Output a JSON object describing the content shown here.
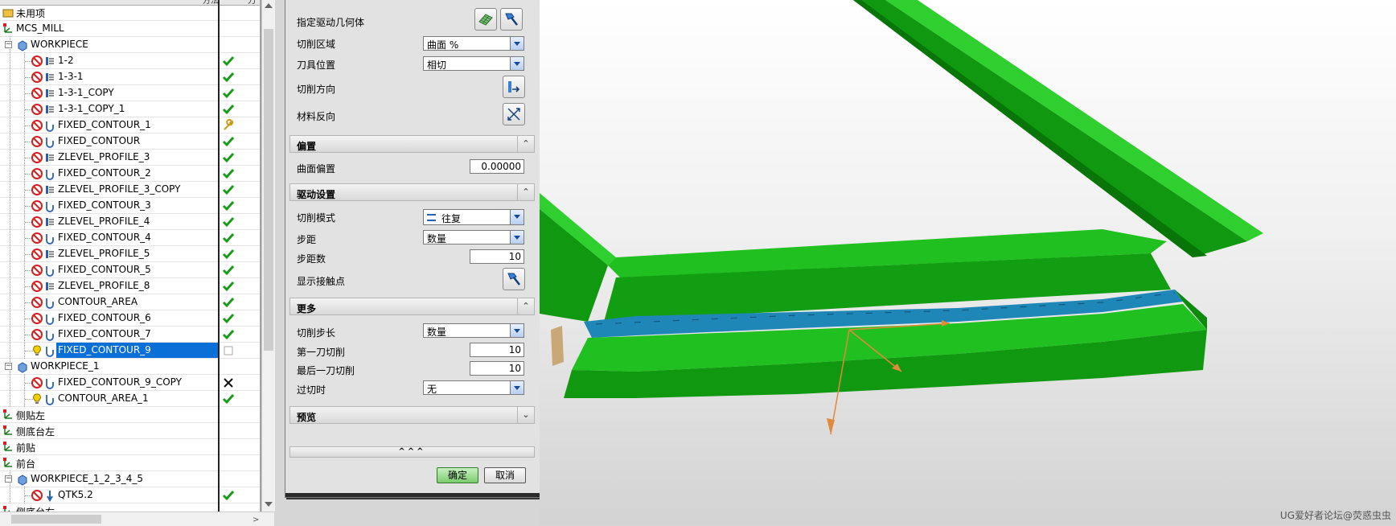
{
  "navigator": {
    "header": {
      "col2": "方法",
      "col3": "刀"
    },
    "rows": [
      {
        "name": "未用项",
        "level": 0,
        "icon": "unused-folder-icon",
        "status": ""
      },
      {
        "name": "MCS_MILL",
        "level": 0,
        "icon": "mcs-axis-icon",
        "status": ""
      },
      {
        "name": "WORKPIECE",
        "level": 1,
        "icon": "workpiece-icon",
        "status": "",
        "expand": "−"
      },
      {
        "name": "1-2",
        "level": 2,
        "icon": "zlevel-op-icon",
        "status": "check"
      },
      {
        "name": "1-3-1",
        "level": 2,
        "icon": "zlevel-op-icon",
        "status": "check"
      },
      {
        "name": "1-3-1_COPY",
        "level": 2,
        "icon": "zlevel-op-icon",
        "status": "check"
      },
      {
        "name": "1-3-1_COPY_1",
        "level": 2,
        "icon": "zlevel-op-icon",
        "status": "check"
      },
      {
        "name": "FIXED_CONTOUR_1",
        "level": 2,
        "icon": "fixed-contour-op-icon",
        "status": "wrench"
      },
      {
        "name": "FIXED_CONTOUR",
        "level": 2,
        "icon": "fixed-contour-op-icon",
        "status": "check"
      },
      {
        "name": "ZLEVEL_PROFILE_3",
        "level": 2,
        "icon": "zlevel-op-icon",
        "status": "check"
      },
      {
        "name": "FIXED_CONTOUR_2",
        "level": 2,
        "icon": "fixed-contour-op-icon",
        "status": "check"
      },
      {
        "name": "ZLEVEL_PROFILE_3_COPY",
        "level": 2,
        "icon": "zlevel-op-icon",
        "status": "check"
      },
      {
        "name": "FIXED_CONTOUR_3",
        "level": 2,
        "icon": "fixed-contour-op-icon",
        "status": "check"
      },
      {
        "name": "ZLEVEL_PROFILE_4",
        "level": 2,
        "icon": "zlevel-op-icon",
        "status": "check"
      },
      {
        "name": "FIXED_CONTOUR_4",
        "level": 2,
        "icon": "fixed-contour-op-icon",
        "status": "check"
      },
      {
        "name": "ZLEVEL_PROFILE_5",
        "level": 2,
        "icon": "zlevel-op-icon",
        "status": "check"
      },
      {
        "name": "FIXED_CONTOUR_5",
        "level": 2,
        "icon": "fixed-contour-op-icon",
        "status": "check"
      },
      {
        "name": "ZLEVEL_PROFILE_8",
        "level": 2,
        "icon": "zlevel-op-icon",
        "status": "check"
      },
      {
        "name": "CONTOUR_AREA",
        "level": 2,
        "icon": "fixed-contour-op-icon",
        "status": "check"
      },
      {
        "name": "FIXED_CONTOUR_6",
        "level": 2,
        "icon": "fixed-contour-op-icon",
        "status": "check"
      },
      {
        "name": "FIXED_CONTOUR_7",
        "level": 2,
        "icon": "fixed-contour-op-icon",
        "status": "check"
      },
      {
        "name": "FIXED_CONTOUR_9",
        "level": 2,
        "icon": "fixed-contour-op-icon",
        "status": "box",
        "selected": true,
        "bulb": true
      },
      {
        "name": "WORKPIECE_1",
        "level": 1,
        "icon": "workpiece-icon",
        "status": "",
        "expand": "−"
      },
      {
        "name": "FIXED_CONTOUR_9_COPY",
        "level": 2,
        "icon": "fixed-contour-op-icon",
        "status": "cross"
      },
      {
        "name": "CONTOUR_AREA_1",
        "level": 2,
        "icon": "fixed-contour-op-icon",
        "status": "check",
        "bulb": true
      },
      {
        "name": "侧贴左",
        "level": 0,
        "icon": "mcs-axis-icon",
        "status": ""
      },
      {
        "name": "侧底台左",
        "level": 0,
        "icon": "mcs-axis-icon",
        "status": ""
      },
      {
        "name": "前贴",
        "level": 0,
        "icon": "mcs-axis-icon",
        "status": ""
      },
      {
        "name": "前台",
        "level": 0,
        "icon": "mcs-axis-icon",
        "status": ""
      },
      {
        "name": "WORKPIECE_1_2_3_4_5",
        "level": 1,
        "icon": "workpiece-icon",
        "status": "",
        "expand": "−"
      },
      {
        "name": "QTK5.2",
        "level": 2,
        "icon": "drill-op-icon",
        "status": "check"
      },
      {
        "name": "侧底台右",
        "level": 0,
        "icon": "mcs-axis-icon",
        "status": ""
      }
    ]
  },
  "dialog": {
    "drive_geometry_label": "指定驱动几何体",
    "cut_region_label": "切削区域",
    "cut_region_value": "曲面 %",
    "tool_position_label": "刀具位置",
    "tool_position_value": "相切",
    "cut_direction_label": "切削方向",
    "material_reverse_label": "材料反向",
    "offset_section": "偏置",
    "surface_offset_label": "曲面偏置",
    "surface_offset_value": "0.00000",
    "drive_settings_section": "驱动设置",
    "cut_mode_label": "切削模式",
    "cut_mode_value": "往复",
    "stepover_label": "步距",
    "stepover_value": "数量",
    "num_steps_label": "步距数",
    "num_steps_value": "10",
    "show_contact_label": "显示接触点",
    "more_section": "更多",
    "cut_step_label": "切削步长",
    "cut_step_value": "数量",
    "first_cut_label": "第一刀切削",
    "first_cut_value": "10",
    "last_cut_label": "最后一刀切削",
    "last_cut_value": "10",
    "overcut_label": "过切时",
    "overcut_value": "无",
    "preview_section": "预览",
    "collapse_glyph": "^^^",
    "ok_label": "确定",
    "cancel_label": "取消"
  },
  "viewport": {
    "watermark": "UG爱好者论坛@荧惑虫虫"
  },
  "colors": {
    "selection": "#0a6fd6",
    "model_green": "#1db41d",
    "surface_blue": "#1f86b8",
    "vector_orange": "#e08a3a",
    "check_green": "#1a9a1a"
  }
}
